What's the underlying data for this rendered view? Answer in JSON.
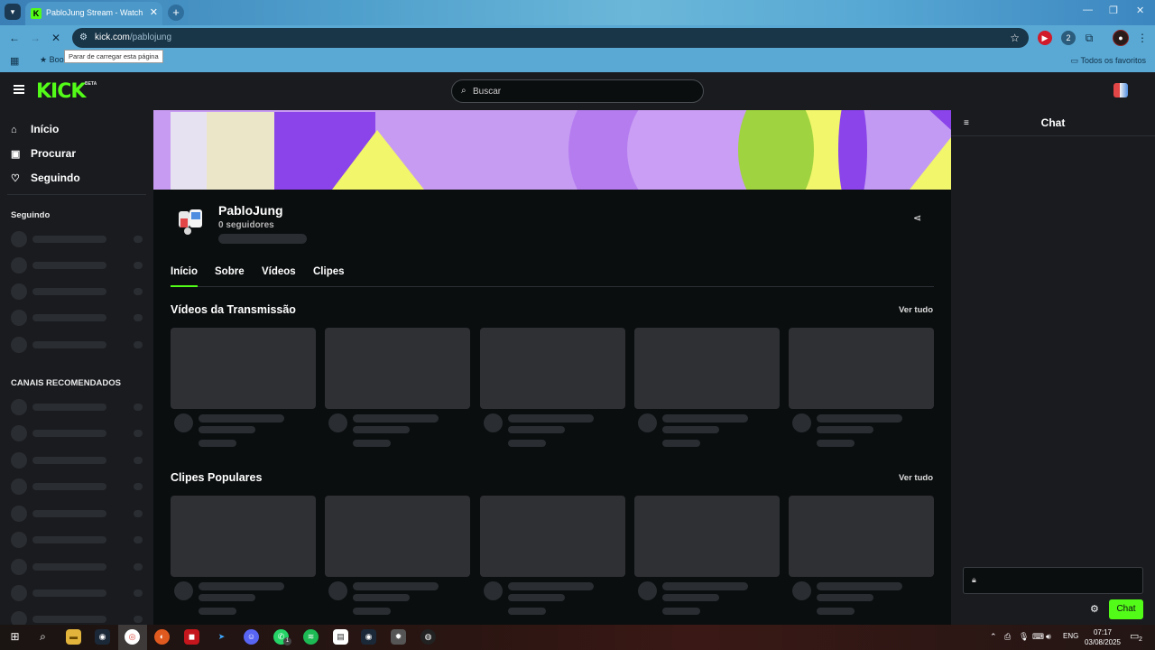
{
  "browser": {
    "tab_title": "PabloJung Stream - Watch Live",
    "tab_favicon": "K",
    "url_domain": "kick.com",
    "url_path": "/pablojung",
    "tooltip": "Parar de carregar esta página",
    "bookmark_item": "Boo",
    "bookmarks_all": "Todos os favoritos",
    "extension_badge": "2"
  },
  "kick": {
    "logo": "KICK",
    "logo_beta": "BETA",
    "search_placeholder": "Buscar",
    "nav": [
      {
        "icon": "home-icon",
        "label": "Início"
      },
      {
        "icon": "browse-icon",
        "label": "Procurar"
      },
      {
        "icon": "heart-icon",
        "label": "Seguindo"
      }
    ],
    "following_heading": "Seguindo",
    "recommended_heading": "CANAIS RECOMENDADOS",
    "channel": {
      "name": "PabloJung",
      "followers": "0 seguidores"
    },
    "tabs": [
      "Início",
      "Sobre",
      "Vídeos",
      "Clipes"
    ],
    "active_tab": "Início",
    "sections": [
      {
        "title": "Vídeos da Transmissão",
        "see_all": "Ver tudo"
      },
      {
        "title": "Clipes Populares",
        "see_all": "Ver tudo"
      }
    ],
    "chat": {
      "title": "Chat",
      "button": "Chat"
    }
  },
  "taskbar": {
    "language": "ENG",
    "time": "07:17",
    "date": "03/08/2025",
    "notification_count": "2",
    "whatsapp_badge": "1"
  },
  "colors": {
    "kick_green": "#53fc18",
    "page_bg": "#0b0e0f",
    "panel_bg": "#191b1f",
    "skeleton": "#2a2d31"
  }
}
